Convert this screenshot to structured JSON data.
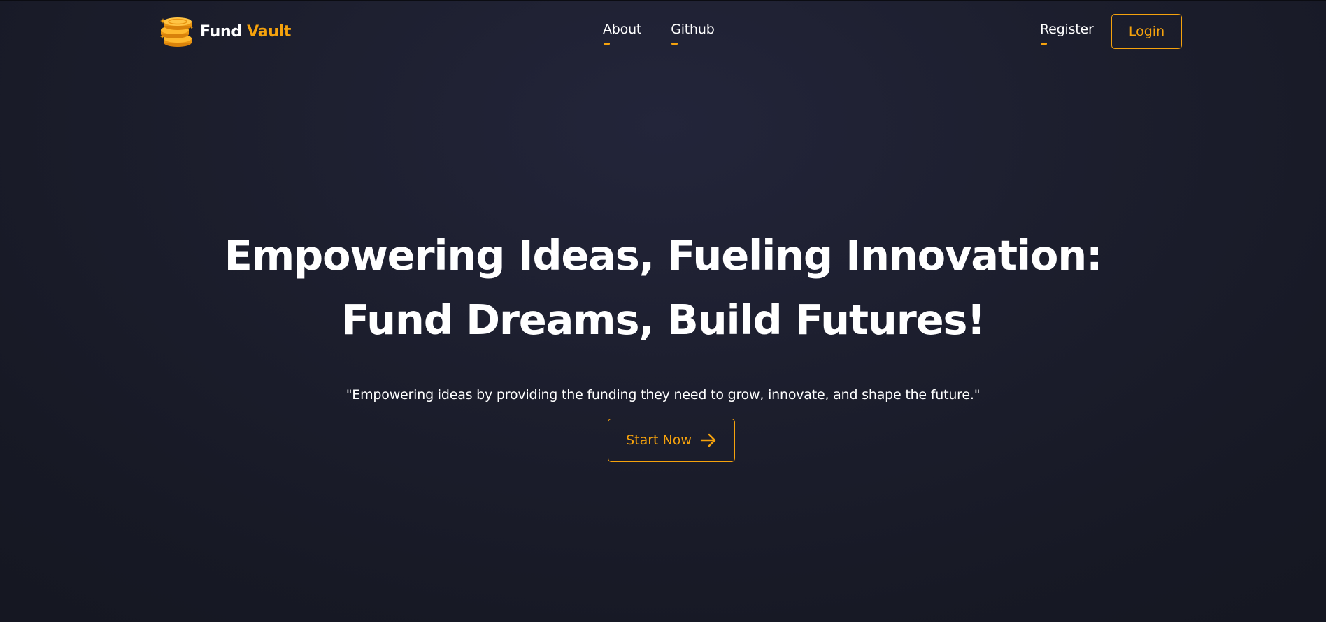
{
  "brand": {
    "name_part1": "Fund",
    "name_part2": "Vault",
    "logo_icon": "coin-stack-icon"
  },
  "nav": {
    "links": [
      {
        "label": "About"
      },
      {
        "label": "Github"
      }
    ],
    "register_label": "Register",
    "login_label": "Login"
  },
  "hero": {
    "title_line1": "Empowering Ideas, Fueling Innovation:",
    "title_line2": "Fund Dreams, Build Futures!",
    "subtitle": "\"Empowering ideas by providing the funding they need to grow, innovate, and shape the future.\"",
    "cta_label": "Start Now",
    "cta_icon": "arrow-right-icon"
  },
  "colors": {
    "accent": "#f5a20d",
    "background": "#1c1e2d",
    "text": "#ffffff"
  }
}
